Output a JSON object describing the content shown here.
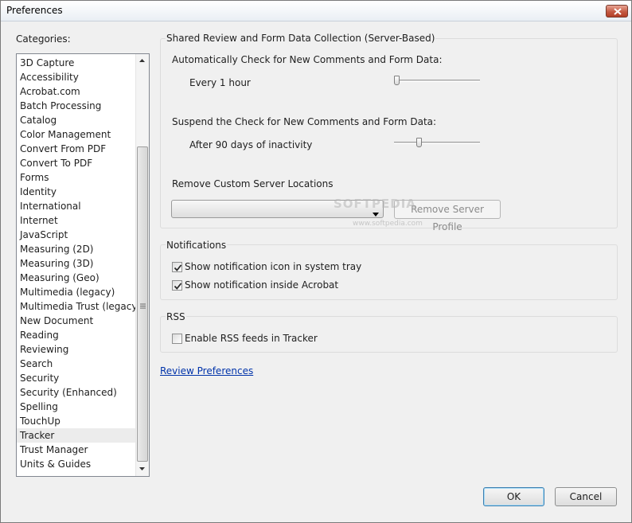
{
  "window": {
    "title": "Preferences"
  },
  "categories": {
    "label": "Categories:",
    "items": [
      "3D Capture",
      "Accessibility",
      "Acrobat.com",
      "Batch Processing",
      "Catalog",
      "Color Management",
      "Convert From PDF",
      "Convert To PDF",
      "Forms",
      "Identity",
      "International",
      "Internet",
      "JavaScript",
      "Measuring (2D)",
      "Measuring (3D)",
      "Measuring (Geo)",
      "Multimedia (legacy)",
      "Multimedia Trust (legacy)",
      "New Document",
      "Reading",
      "Reviewing",
      "Search",
      "Security",
      "Security (Enhanced)",
      "Spelling",
      "TouchUp",
      "Tracker",
      "Trust Manager",
      "Units & Guides"
    ],
    "selected": "Tracker"
  },
  "shared_review": {
    "title": "Shared Review and Form Data Collection (Server-Based)",
    "auto_check_label": "Automatically Check for New Comments and Form Data:",
    "auto_check_value": "Every 1 hour",
    "auto_check_slider_position": 0.0,
    "suspend_label": "Suspend the Check for New Comments and Form Data:",
    "suspend_value": "After 90 days of inactivity",
    "suspend_slider_position": 0.25,
    "remove_label": "Remove Custom Server Locations",
    "server_dropdown_value": "",
    "remove_button": "Remove Server Profile"
  },
  "notifications": {
    "title": "Notifications",
    "system_tray_label": "Show notification icon in system tray",
    "system_tray_checked": true,
    "inside_acrobat_label": "Show notification inside Acrobat",
    "inside_acrobat_checked": true
  },
  "rss": {
    "title": "RSS",
    "enable_label": "Enable RSS feeds in Tracker",
    "enable_checked": false
  },
  "review_link": "Review Preferences",
  "watermark": {
    "main": "SOFTPEDIA",
    "sub": "www.softpedia.com"
  },
  "buttons": {
    "ok": "OK",
    "cancel": "Cancel"
  },
  "colors": {
    "link": "#0033aa",
    "close_button": "#c45a43",
    "default_button_border": "#3c7fb1"
  }
}
